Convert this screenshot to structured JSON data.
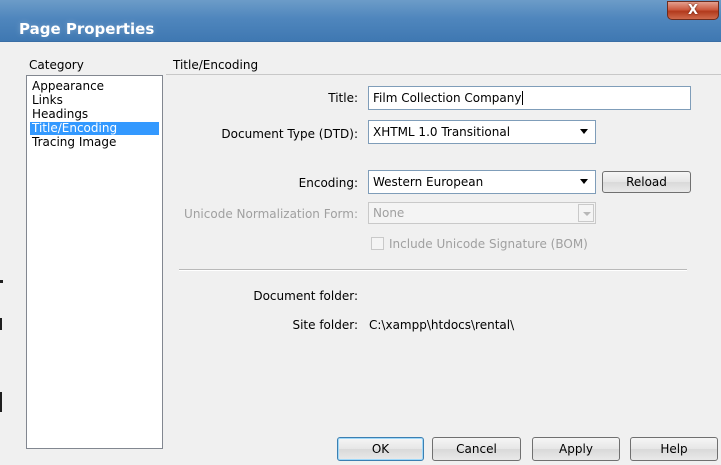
{
  "window": {
    "title": "Page Properties",
    "close_label": "X"
  },
  "category": {
    "label": "Category",
    "items": [
      {
        "label": "Appearance"
      },
      {
        "label": "Links"
      },
      {
        "label": "Headings"
      },
      {
        "label": "Title/Encoding",
        "selected": true
      },
      {
        "label": "Tracing Image"
      }
    ]
  },
  "section": {
    "title": "Title/Encoding"
  },
  "form": {
    "title_label": "Title:",
    "title_value": "Film Collection Company",
    "doctype_label": "Document Type (DTD):",
    "doctype_value": "XHTML 1.0 Transitional",
    "encoding_label": "Encoding:",
    "encoding_value": "Western European",
    "reload_label": "Reload",
    "normalization_label": "Unicode Normalization Form:",
    "normalization_value": "None",
    "bom_label": "Include Unicode Signature (BOM)",
    "document_folder_label": "Document folder:",
    "document_folder_value": "",
    "site_folder_label": "Site folder:",
    "site_folder_value": "C:\\xampp\\htdocs\\rental\\"
  },
  "buttons": {
    "ok": "OK",
    "cancel": "Cancel",
    "apply": "Apply",
    "help": "Help"
  },
  "colors": {
    "titlebar": "#4f86bd",
    "selection": "#3399ff",
    "close_button": "#cc5a3f"
  }
}
